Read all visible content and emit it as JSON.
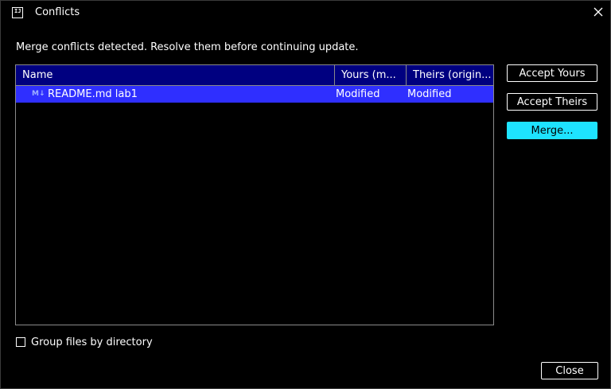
{
  "window": {
    "title": "Conflicts",
    "app_icon_text": "IJ",
    "close_icon": "close-icon"
  },
  "message": "Merge conflicts detected. Resolve them before continuing update.",
  "table": {
    "columns": [
      "Name",
      "Yours (m...",
      "Theirs (origin..."
    ],
    "rows": [
      {
        "icon_text": "M↓",
        "name": "README.md  lab1",
        "yours": "Modified",
        "theirs": "Modified",
        "selected": true
      }
    ]
  },
  "actions": {
    "accept_yours": "Accept Yours",
    "accept_theirs": "Accept Theirs",
    "merge": "Merge..."
  },
  "group_by_directory": {
    "label": "Group files by directory",
    "checked": false
  },
  "close_button": "Close",
  "colors": {
    "background": "#000000",
    "header_bg": "#000080",
    "selection": "#2f2fff",
    "primary_button": "#1ee3ff"
  }
}
